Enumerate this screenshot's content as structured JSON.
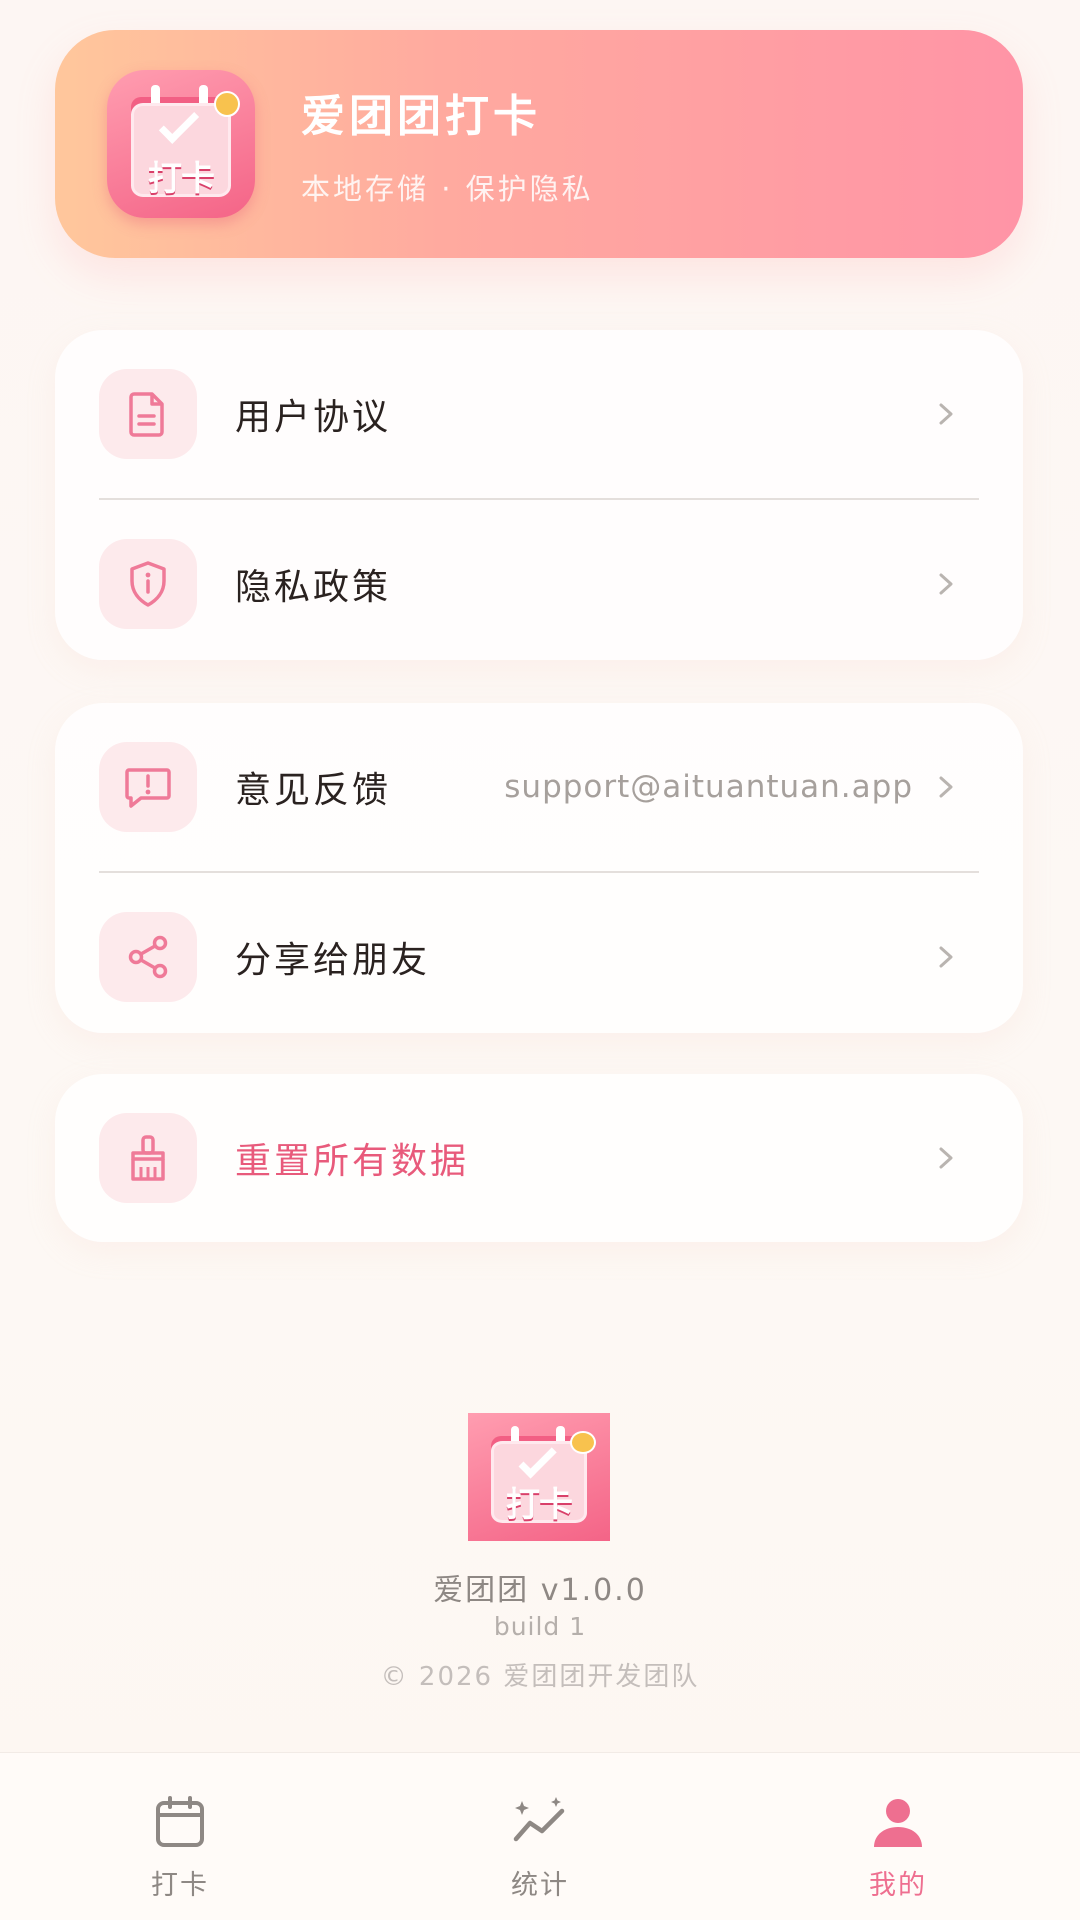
{
  "header": {
    "title": "爱团团打卡",
    "subtitle": "本地存储 · 保护隐私",
    "icon_text": "打卡"
  },
  "menu": {
    "group1": [
      {
        "label": "用户协议",
        "icon": "document-icon"
      },
      {
        "label": "隐私政策",
        "icon": "shield-info-icon"
      }
    ],
    "group2": [
      {
        "label": "意见反馈",
        "icon": "feedback-icon",
        "value": "support@aituantuan.app"
      },
      {
        "label": "分享给朋友",
        "icon": "share-icon"
      }
    ],
    "group3": [
      {
        "label": "重置所有数据",
        "icon": "broom-icon"
      }
    ]
  },
  "footer": {
    "logo_text": "打卡",
    "version": "爱团团  v1.0.0",
    "build": "build 1",
    "copyright": "© 2026 爱团团开发团队"
  },
  "tabbar": {
    "tabs": [
      {
        "label": "打卡",
        "icon": "calendar-icon",
        "active": false
      },
      {
        "label": "统计",
        "icon": "stats-sparkle-icon",
        "active": false
      },
      {
        "label": "我的",
        "icon": "user-icon",
        "active": true
      }
    ]
  },
  "colors": {
    "accent": "#ee6f90",
    "danger_text": "#e85a7b",
    "header_gradient_start": "#ffc79c",
    "header_gradient_end": "#ff94a6",
    "icon_bg": "#fdeaec"
  }
}
